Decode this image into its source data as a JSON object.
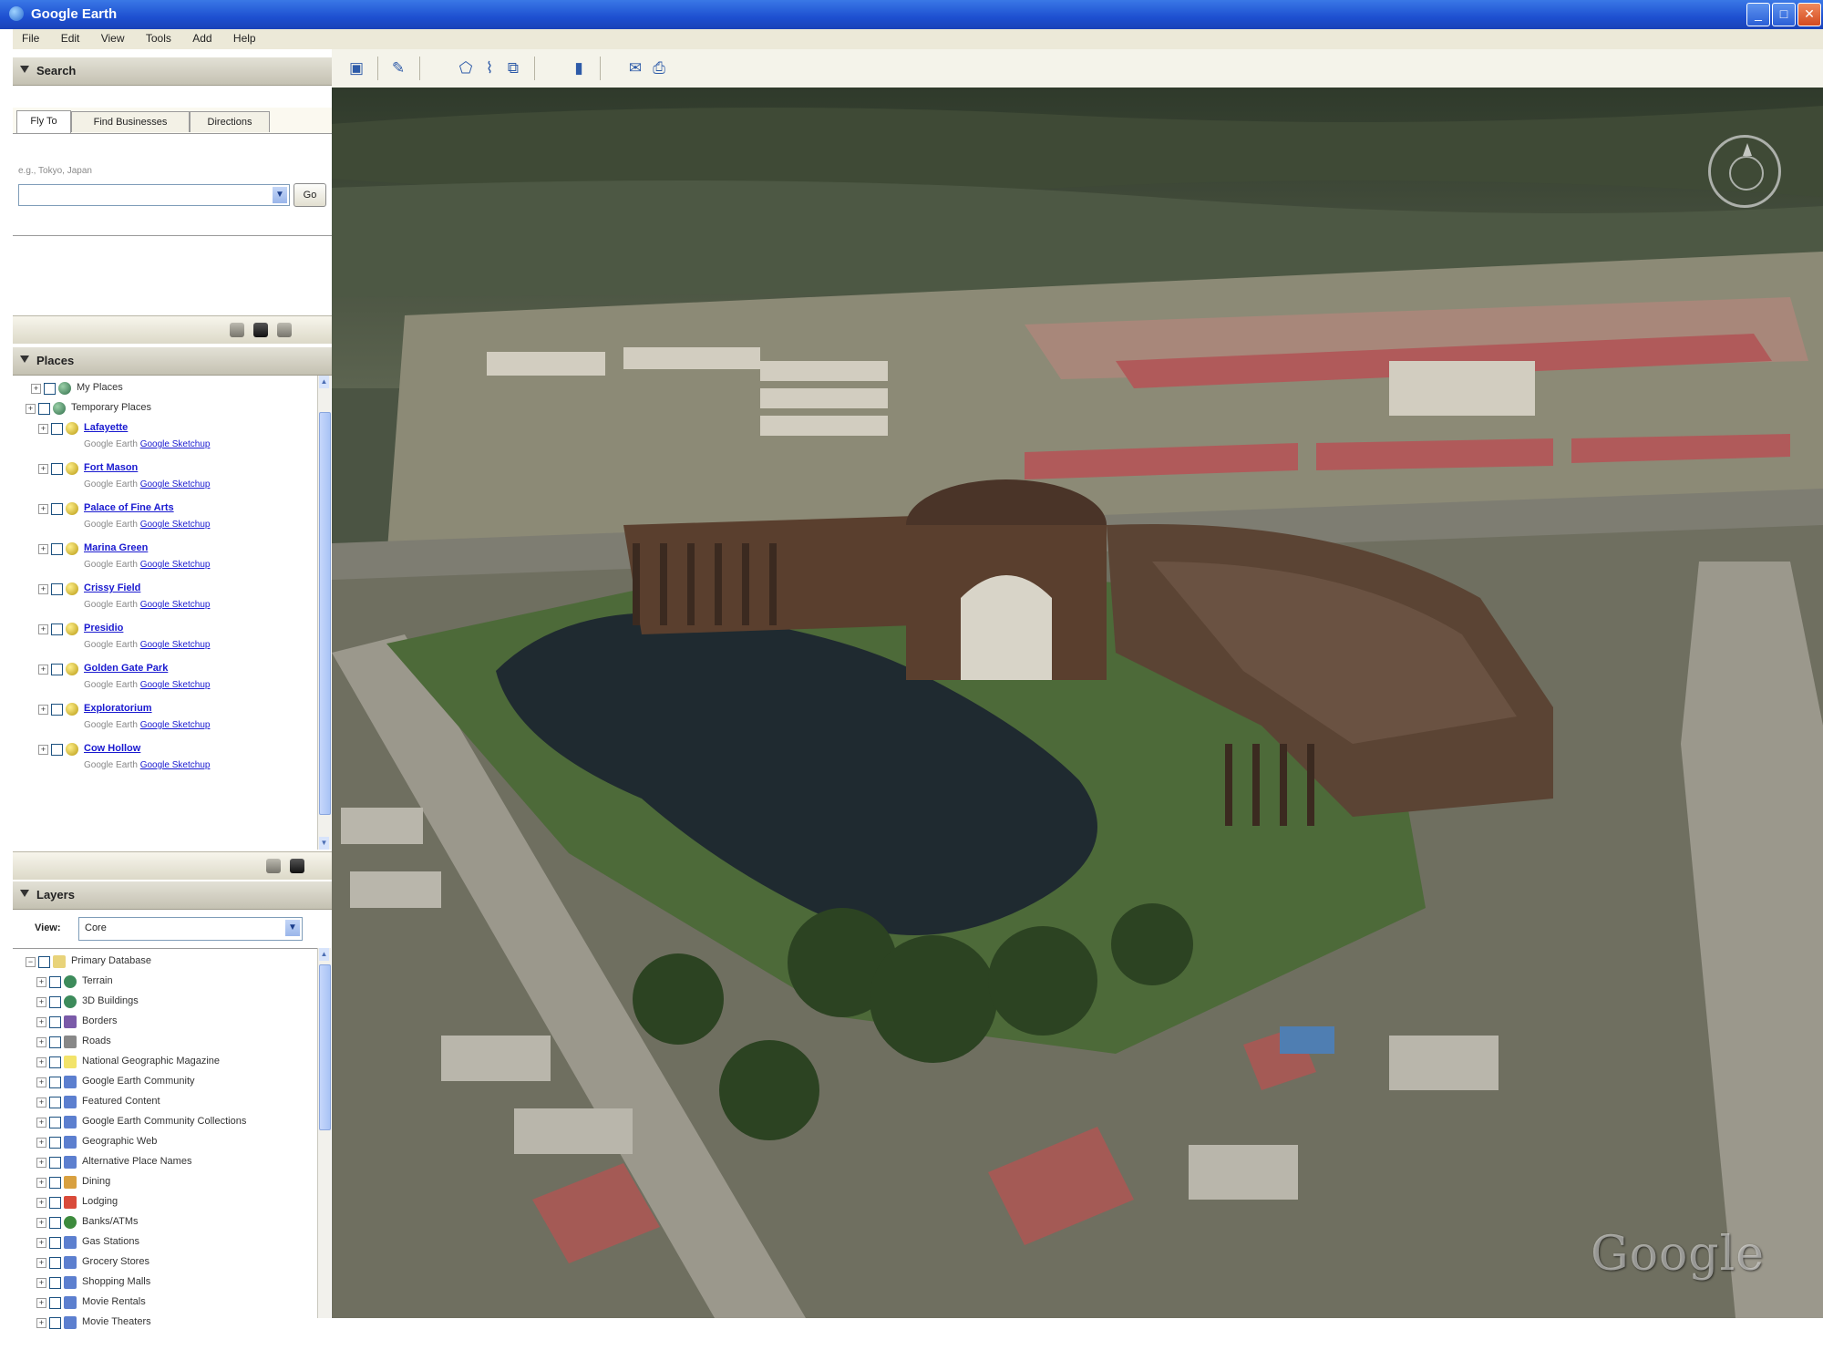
{
  "window": {
    "title": "Google Earth",
    "minimize": "_",
    "maximize": "□",
    "close": "✕"
  },
  "menu": [
    "File",
    "Edit",
    "View",
    "Tools",
    "Add",
    "Help"
  ],
  "search": {
    "header": "Search",
    "tabs": [
      "Fly To",
      "Find Businesses",
      "Directions"
    ],
    "hint": "e.g., Tokyo, Japan",
    "input_value": "",
    "go_label": "Go"
  },
  "places": {
    "header": "Places",
    "items": [
      {
        "label": "My Places",
        "type": "folder",
        "link": false
      },
      {
        "label": "Temporary Places",
        "type": "folder",
        "link": false
      },
      {
        "label": "Lafayette",
        "type": "placemark",
        "link": true,
        "sub": "Google Earth",
        "sub_link": "Google Sketchup"
      },
      {
        "label": "Fort Mason",
        "type": "placemark",
        "link": true,
        "sub": "Google Earth",
        "sub_link": "Google Sketchup"
      },
      {
        "label": "Palace of Fine Arts",
        "type": "placemark",
        "link": true,
        "sub": "Google Earth",
        "sub_link": "Google Sketchup"
      },
      {
        "label": "Marina Green",
        "type": "placemark",
        "link": true,
        "sub": "Google Earth",
        "sub_link": "Google Sketchup"
      },
      {
        "label": "Crissy Field",
        "type": "placemark",
        "link": true,
        "sub": "Google Earth",
        "sub_link": "Google Sketchup"
      },
      {
        "label": "Presidio",
        "type": "placemark",
        "link": true,
        "sub": "Google Earth",
        "sub_link": "Google Sketchup"
      },
      {
        "label": "Golden Gate Park",
        "type": "placemark",
        "link": true,
        "sub": "Google Earth",
        "sub_link": "Google Sketchup"
      },
      {
        "label": "Exploratorium",
        "type": "placemark",
        "link": true,
        "sub": "Google Earth",
        "sub_link": "Google Sketchup"
      },
      {
        "label": "Cow Hollow",
        "type": "placemark",
        "link": true,
        "sub": "Google Earth",
        "sub_link": "Google Sketchup"
      }
    ]
  },
  "layers": {
    "header": "Layers",
    "view_label": "View:",
    "view_value": "Core",
    "items": [
      {
        "label": "Primary Database",
        "type": "folder"
      },
      {
        "label": "Terrain",
        "type": "globe"
      },
      {
        "label": "3D Buildings",
        "type": "globe"
      },
      {
        "label": "Borders",
        "type": "border"
      },
      {
        "label": "Roads",
        "type": "road"
      },
      {
        "label": "National Geographic Magazine",
        "type": "yellow"
      },
      {
        "label": "Google Earth Community",
        "type": "blue"
      },
      {
        "label": "Featured Content",
        "type": "blue"
      },
      {
        "label": "Google Earth Community Collections",
        "type": "blue"
      },
      {
        "label": "Geographic Web",
        "type": "blue"
      },
      {
        "label": "Alternative Place Names",
        "type": "blue"
      },
      {
        "label": "Dining",
        "type": "dining"
      },
      {
        "label": "Lodging",
        "type": "red"
      },
      {
        "label": "Banks/ATMs",
        "type": "green"
      },
      {
        "label": "Gas Stations",
        "type": "blue"
      },
      {
        "label": "Grocery Stores",
        "type": "blue"
      },
      {
        "label": "Shopping Malls",
        "type": "blue"
      },
      {
        "label": "Movie Rentals",
        "type": "blue"
      },
      {
        "label": "Movie Theaters",
        "type": "blue"
      }
    ]
  },
  "toolbar": {
    "buttons": [
      "sidebar-toggle-icon",
      "placemark-icon",
      "polygon-icon",
      "path-icon",
      "image-overlay-icon",
      "ruler-icon",
      "email-icon",
      "print-icon"
    ]
  },
  "map": {
    "watermark": "Google",
    "compass": "north-compass-icon"
  },
  "colors": {
    "titlebar": "#2455d4",
    "panel_header": "#d4d1c3",
    "link": "#1a1ad0",
    "water": "#1f2a30",
    "grass": "#3e5a2e",
    "building": "#5a3f2e"
  }
}
